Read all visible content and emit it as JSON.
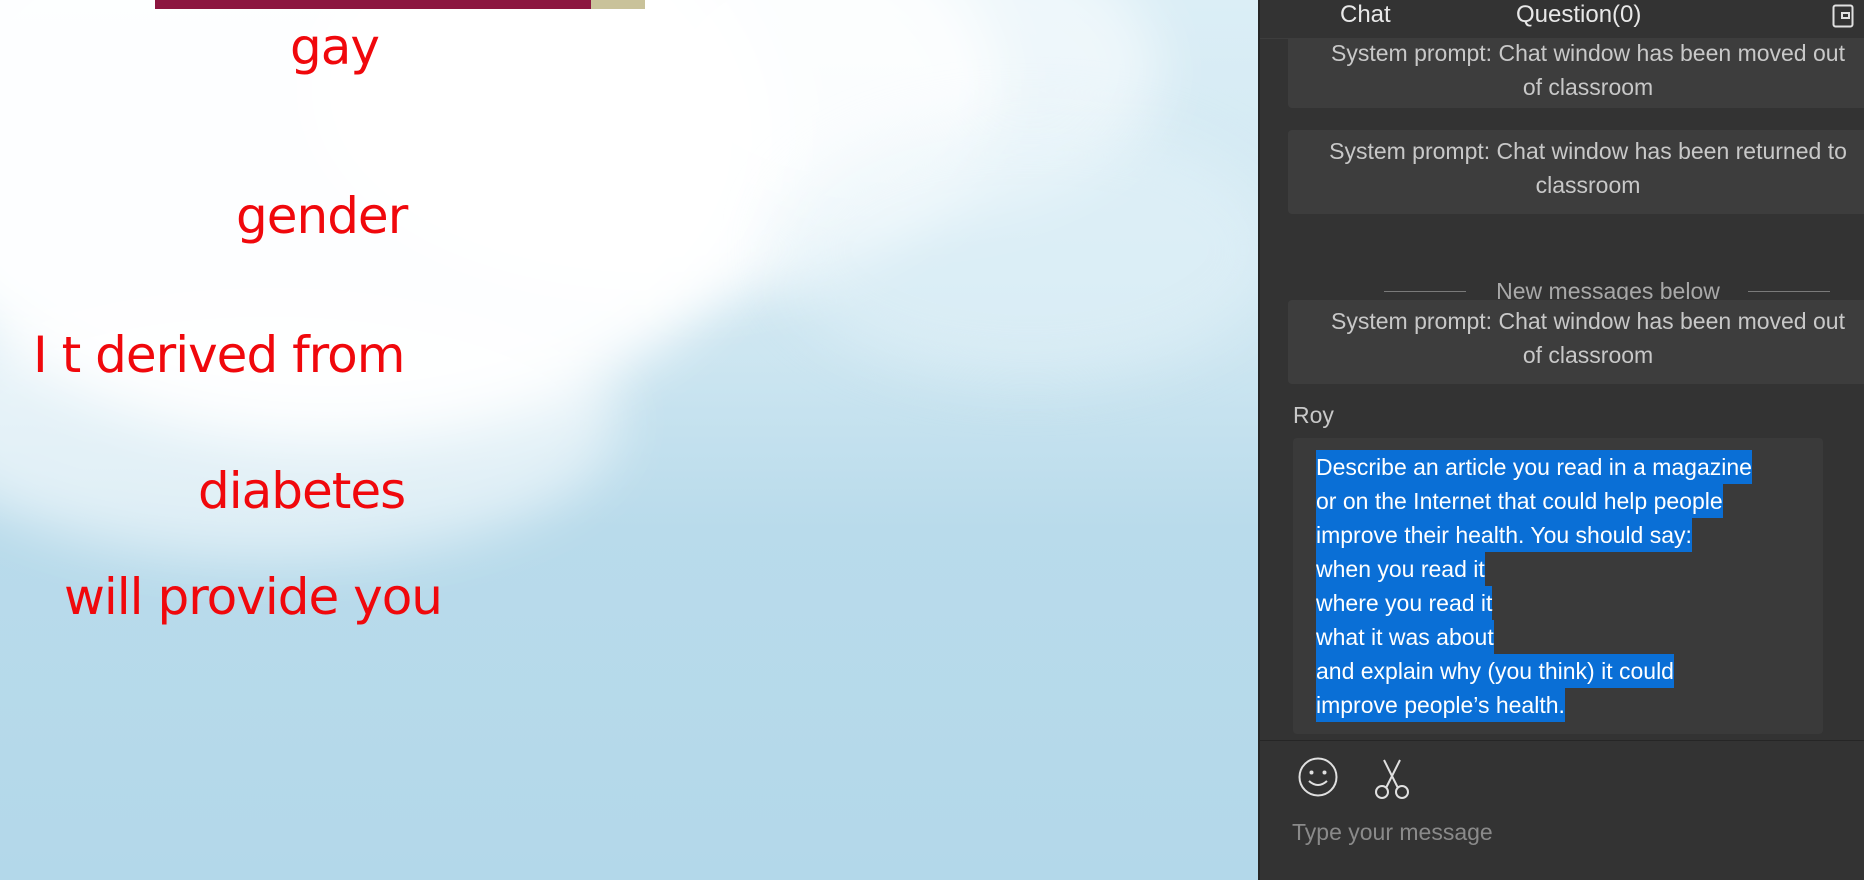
{
  "board": {
    "words": [
      "gay",
      "gender",
      "I t  derived from",
      "diabetes",
      "will provide you"
    ],
    "text_color": "#f0080c"
  },
  "chat_panel": {
    "tabs": {
      "chat": "Chat",
      "question": "Question(0)"
    },
    "icons": {
      "popout": "popout-window-icon",
      "emoji": "smiley-face-icon",
      "screenshot": "scissors-icon"
    },
    "system_messages": [
      {
        "line1": "System prompt: Chat window has been moved out",
        "line2": "of classroom"
      },
      {
        "line1": "System prompt: Chat window has been returned to",
        "line2": "classroom"
      },
      {
        "line1": "System prompt: Chat window has been moved out",
        "line2": "of classroom"
      }
    ],
    "divider_text": "New messages below",
    "message": {
      "sender": "Roy",
      "lines": [
        "Describe an article you read in a magazine",
        "or on the Internet that could help people",
        "improve their health. You should say:",
        "when you read it",
        "where you read it",
        "what it was about",
        "and explain why (you think) it could",
        "improve people’s health."
      ],
      "highlight_color": "#0a6fd6"
    },
    "composer": {
      "placeholder": "Type your message"
    }
  }
}
